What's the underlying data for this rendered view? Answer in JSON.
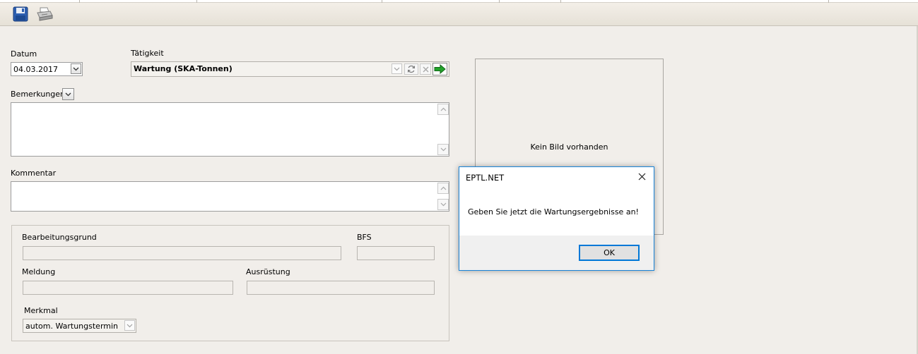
{
  "form": {
    "datum_label": "Datum",
    "datum_value": "04.03.2017",
    "taetigkeit_label": "Tätigkeit",
    "taetigkeit_value": "Wartung (SKA-Tonnen)",
    "bemerkungen_label": "Bemerkungen",
    "kommentar_label": "Kommentar",
    "bearbeitungsgrund_label": "Bearbeitungsgrund",
    "bfs_label": "BFS",
    "meldung_label": "Meldung",
    "ausruestung_label": "Ausrüstung",
    "merkmal_label": "Merkmal",
    "merkmal_value": "autom. Wartungstermin"
  },
  "picture": {
    "no_image_text": "Kein Bild vorhanden"
  },
  "dialog": {
    "title": "EPTL.NET",
    "message": "Geben Sie jetzt die Wartungsergebnisse an!",
    "ok_label": "OK"
  },
  "icons": {
    "save": "floppy-disk-icon",
    "print": "printer-icon"
  },
  "colors": {
    "background": "#f1eeea",
    "dialog_border": "#1883d7",
    "ok_border": "#0078d7",
    "go_arrow": "#22a32a"
  }
}
